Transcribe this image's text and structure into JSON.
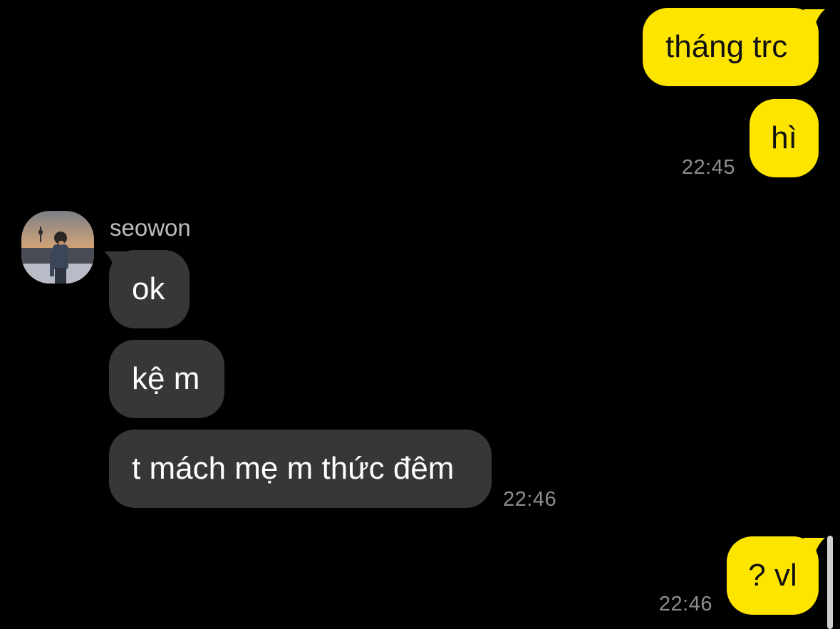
{
  "colors": {
    "background": "#000000",
    "outgoing_bubble": "#fee500",
    "incoming_bubble": "#373737",
    "timestamp": "#8e8e8e"
  },
  "chat": {
    "messages": [
      {
        "direction": "outgoing",
        "text": "tháng trc"
      },
      {
        "direction": "outgoing",
        "text": "hì",
        "time": "22:45"
      },
      {
        "direction": "incoming",
        "text": "ok"
      },
      {
        "direction": "incoming",
        "text": "kệ m"
      },
      {
        "direction": "incoming",
        "text": "t mách mẹ m thức đêm",
        "time": "22:46"
      },
      {
        "direction": "outgoing",
        "text": "? vl",
        "time": "22:46"
      }
    ],
    "contact": {
      "name": "seowon",
      "avatar_icon": "profile-photo"
    }
  }
}
